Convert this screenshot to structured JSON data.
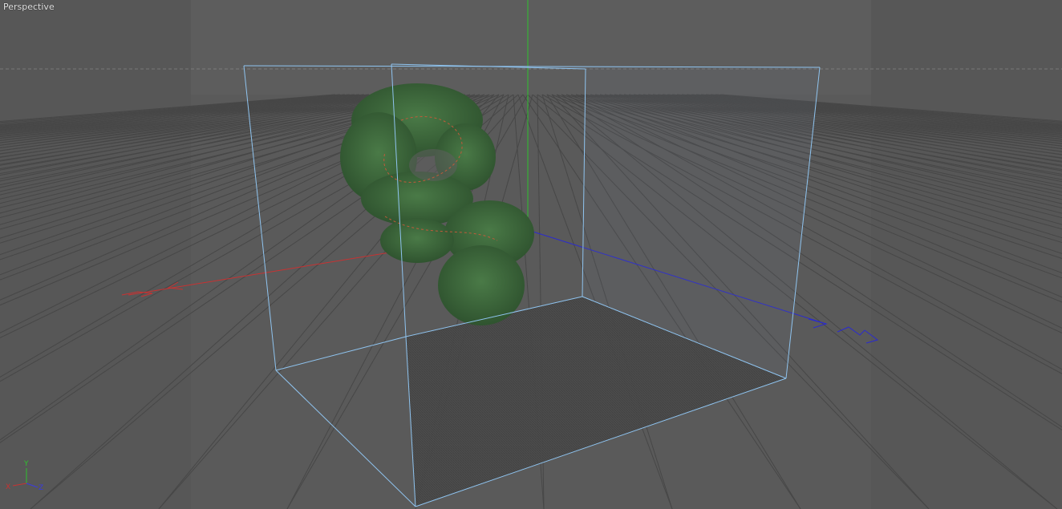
{
  "viewport": {
    "name": "Perspective",
    "axis_indicator": {
      "x": "X",
      "y": "Y",
      "z": "Z"
    }
  },
  "colors": {
    "background": "#5a5a5a",
    "sky": "#5e5e5e",
    "grid": "#4a4a4a",
    "axis_x": "#c83232",
    "axis_y": "#2ec22e",
    "axis_z": "#2a2ad0",
    "selection_box": "#8fc4f0",
    "foliage": "#3f6b3f",
    "foliage_dark": "#2f552f"
  }
}
